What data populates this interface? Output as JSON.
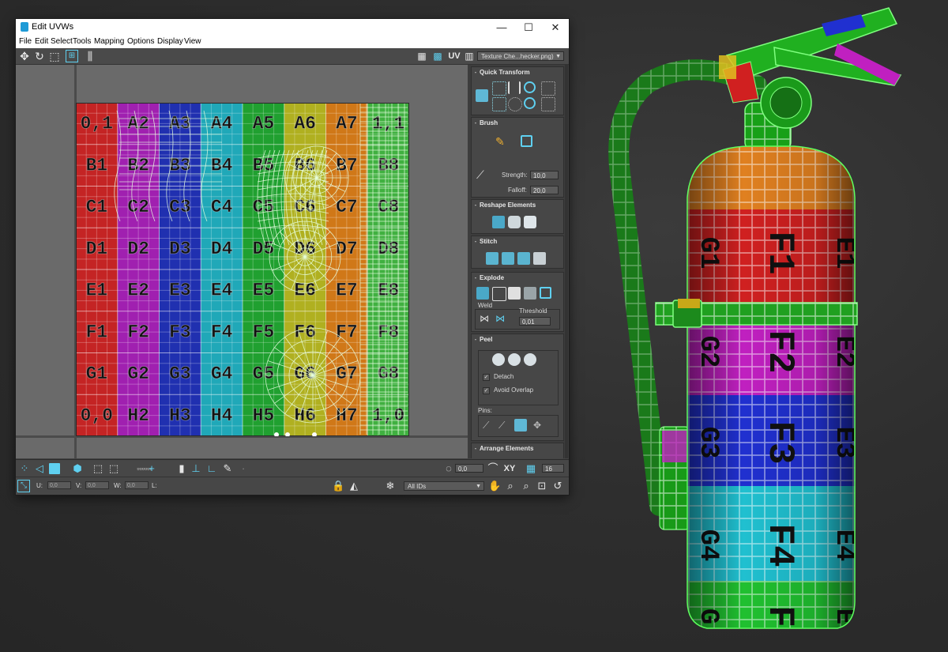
{
  "window": {
    "title": "Edit UVWs",
    "controls": {
      "minimize": "—",
      "maximize": "☐",
      "close": "✕"
    }
  },
  "menu": [
    "File",
    "Edit",
    "Select",
    "Tools",
    "Mapping",
    "Options",
    "Display",
    "View"
  ],
  "toolbar": {
    "uv_label": "UV",
    "texture_select": "Texture Che...hecker.png)"
  },
  "uv_grid": {
    "rows": [
      "A",
      "B",
      "C",
      "D",
      "E",
      "F",
      "G",
      "H"
    ],
    "cols": 8,
    "corner_labels": {
      "top_left": "0,1",
      "top_right": "1,1",
      "bottom_left": "0,0",
      "bottom_right": "1,0"
    },
    "column_colors": [
      "#c42424",
      "#a020b0",
      "#2030b0",
      "#20a8b8",
      "#20a030",
      "#b0b020",
      "#d07818",
      "#40b040"
    ]
  },
  "panel": {
    "rollouts": {
      "quick_transform": "Quick Transform",
      "brush": "Brush",
      "reshape": "Reshape Elements",
      "stitch": "Stitch",
      "explode": "Explode",
      "peel": "Peel",
      "arrange": "Arrange Elements"
    },
    "brush": {
      "strength_label": "Strength:",
      "strength_value": "10,0",
      "falloff_label": "Falloff:",
      "falloff_value": "20,0"
    },
    "explode": {
      "weld_label": "Weld",
      "threshold_label": "Threshold",
      "threshold_value": "0,01"
    },
    "peel": {
      "detach_label": "Detach",
      "avoid_overlap_label": "Avoid Overlap",
      "pins_label": "Pins:"
    }
  },
  "bottom": {
    "rotate_value": "0,0",
    "xy_label": "XY",
    "grid_value": "16",
    "u_label": "U:",
    "u_value": "0,0",
    "v_label": "V:",
    "v_value": "0,0",
    "w_label": "W:",
    "w_value": "0,0",
    "l_label": "L:",
    "ids_select": "All IDs"
  },
  "scene": {
    "label_rows": [
      "E",
      "F",
      "G"
    ],
    "band_colors": [
      "#e08020",
      "#d02020",
      "#c020c0",
      "#2030d0",
      "#20c0d0",
      "#20c030"
    ]
  }
}
